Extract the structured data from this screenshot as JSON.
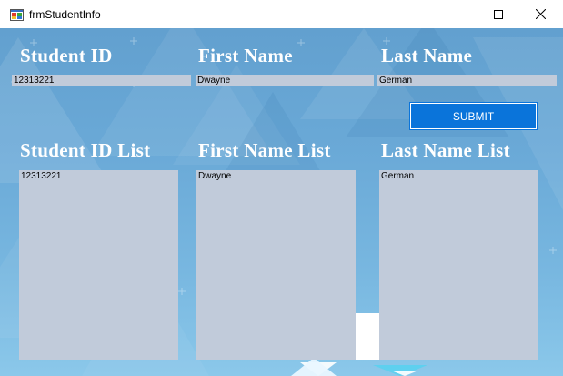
{
  "window": {
    "title": "frmStudentInfo",
    "icon": "winforms-app-icon",
    "controls": [
      "minimize-icon",
      "maximize-icon",
      "close-icon"
    ]
  },
  "colors": {
    "background_blue": "#6aa9d7",
    "field_gray": "#c1cbda",
    "button_blue": "#0a74da",
    "header_text": "#ffffff"
  },
  "form": {
    "student_id": {
      "label": "Student ID",
      "value": "12313221"
    },
    "first_name": {
      "label": "First Name",
      "value": "Dwayne"
    },
    "last_name": {
      "label": "Last Name",
      "value": "German"
    },
    "submit_label": "SUBMIT"
  },
  "lists": {
    "student_id": {
      "label": "Student ID List",
      "items": [
        "12313221"
      ]
    },
    "first_name": {
      "label": "First Name List",
      "items": [
        "Dwayne"
      ]
    },
    "last_name": {
      "label": "Last Name List",
      "items": [
        "German"
      ]
    }
  }
}
